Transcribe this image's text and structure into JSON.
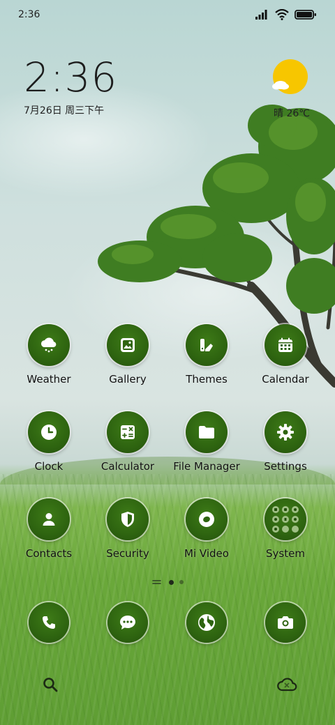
{
  "status_bar": {
    "time": "2:36",
    "battery_level": 1.0
  },
  "clock_widget": {
    "time": "2:36",
    "date": "7月26日 周三下午"
  },
  "weather_widget": {
    "condition_temp": "晴 26℃",
    "icon": "sun-cloud-icon"
  },
  "apps": [
    {
      "label": "Weather",
      "icon": "weather-cloud-icon"
    },
    {
      "label": "Gallery",
      "icon": "gallery-icon"
    },
    {
      "label": "Themes",
      "icon": "themes-icon"
    },
    {
      "label": "Calendar",
      "icon": "calendar-icon"
    },
    {
      "label": "Clock",
      "icon": "clock-icon"
    },
    {
      "label": "Calculator",
      "icon": "calculator-icon"
    },
    {
      "label": "File Manager",
      "icon": "folder-icon"
    },
    {
      "label": "Settings",
      "icon": "gear-icon"
    },
    {
      "label": "Contacts",
      "icon": "person-icon"
    },
    {
      "label": "Security",
      "icon": "shield-icon"
    },
    {
      "label": "Mi Video",
      "icon": "video-icon"
    },
    {
      "label": "System",
      "icon": "folder-grid-icon"
    }
  ],
  "dock": [
    {
      "icon": "phone-icon"
    },
    {
      "icon": "message-icon"
    },
    {
      "icon": "browser-icon"
    },
    {
      "icon": "camera-icon"
    }
  ],
  "page_indicator": {
    "pages": 2,
    "current": 1
  },
  "colors": {
    "icon_bg": "#2e6410",
    "icon_glyph": "#ffffff"
  }
}
